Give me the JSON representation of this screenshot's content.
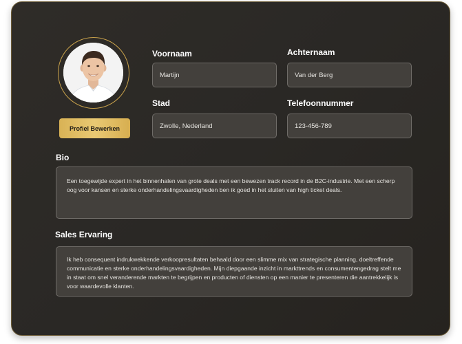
{
  "profile": {
    "avatar_icon": "user-photo",
    "edit_button_label": "Profiel Bewerken"
  },
  "fields": {
    "first_name": {
      "label": "Voornaam",
      "value": "Martijn"
    },
    "last_name": {
      "label": "Achternaam",
      "value": "Van der Berg"
    },
    "city": {
      "label": "Stad",
      "value": "Zwolle, Nederland"
    },
    "phone": {
      "label": "Telefoonnummer",
      "value": "123-456-789"
    }
  },
  "bio": {
    "label": "Bio",
    "text": "Een toegewijde expert in het binnenhalen van grote deals met een bewezen track record in de B2C-industrie. Met een scherp oog voor kansen en sterke onderhandelingsvaardigheden ben ik goed in het sluiten van high ticket deals."
  },
  "sales_experience": {
    "label": "Sales Ervaring",
    "text": "Ik heb consequent indrukwekkende verkoopresultaten behaald door een slimme mix van strategische planning, doeltreffende communicatie en sterke onderhandelingsvaardigheden. Mijn diepgaande inzicht in markttrends en consumentengedrag stelt me in staat om snel veranderende markten te begrijpen en producten of diensten op een manier te presenteren die aantrekkelijk is voor waardevolle klanten."
  },
  "colors": {
    "accent_gold": "#d9b255",
    "card_background": "#2c2926",
    "field_background": "#43403c"
  }
}
